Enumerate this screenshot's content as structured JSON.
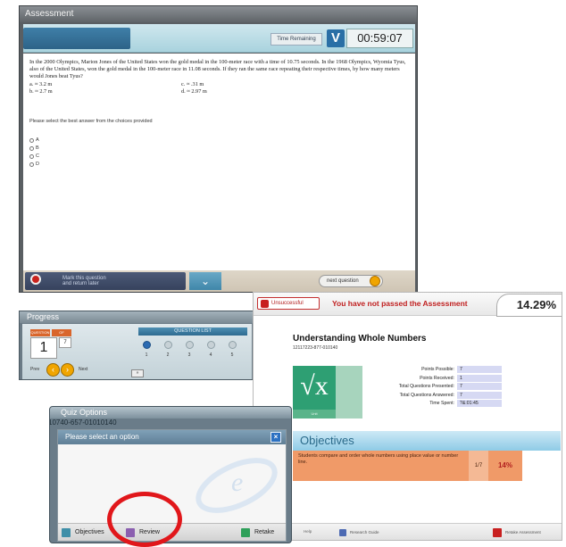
{
  "assessment": {
    "title": "Assessment",
    "time_label": "Time Remaining",
    "timer": "00:59:07",
    "question": "In the 2000 Olympics, Marion Jones of the United States won the gold medal in the 100-meter race with a time of 10.75 seconds. In the 1968 Olympics, Wyomia Tyus, also of the United States, won the gold medal in the 100-meter race in 11.08 seconds. If they ran the same race repeating their respective times, by how many meters would Jones beat Tyus?",
    "choices": [
      "a.  ≈ 3.2 m",
      "c.  ≈ .31 m",
      "b.  ≈ 2.7 m",
      "d.  ≈ 2.97 m"
    ],
    "instruction": "Please select the best answer from the choices provided",
    "options": [
      "A",
      "B",
      "C",
      "D"
    ],
    "mark_label_1": "Mark this question",
    "mark_label_2": "and return later",
    "next_label": "next question"
  },
  "progress": {
    "title": "Progress",
    "question_label": "QUESTION",
    "of_label": "OF",
    "current": "1",
    "total": "7",
    "prev_label": "Prev",
    "next_label": "Next",
    "list_title": "QUESTION LIST",
    "list": [
      "1",
      "2",
      "3",
      "4",
      "5"
    ],
    "nav_arrow": "»"
  },
  "results": {
    "unsuccessful": "Unsuccessful",
    "message": "You have not passed the Assessment",
    "percent": "14.29%",
    "title": "Understanding Whole Numbers",
    "code": "12117223-877-010140",
    "sqrt_symbol": "√x",
    "sqrt_caption": "Unit",
    "stats": [
      {
        "label": "Points Possible:",
        "value": "7"
      },
      {
        "label": "Points Received:",
        "value": "1"
      },
      {
        "label": "Total Questions Presented:",
        "value": "7"
      },
      {
        "label": "Total Questions Answered:",
        "value": "7"
      },
      {
        "label": "Time Spent:",
        "value": "?&:01:45"
      }
    ],
    "objectives_title": "Objectives",
    "objective_text": "Students compare and order whole numbers using place value or number line.",
    "objective_fraction": "1/7",
    "objective_percent": "14%",
    "footer_help": "Help",
    "footer_study": "Research Guide",
    "footer_retake": "Retake Assessment"
  },
  "quiz_options": {
    "title": "Quiz Options",
    "code": "10740-657-01010140",
    "prompt": "Please select an option",
    "close": "×",
    "objectives_btn": "Objectives",
    "review_btn": "Review",
    "retake_btn": "Retake"
  },
  "colors": {
    "highlight": "#e1171b",
    "fail_red": "#c02020",
    "objective_orange": "#f09a68",
    "unit_green": "#2e9f73"
  }
}
